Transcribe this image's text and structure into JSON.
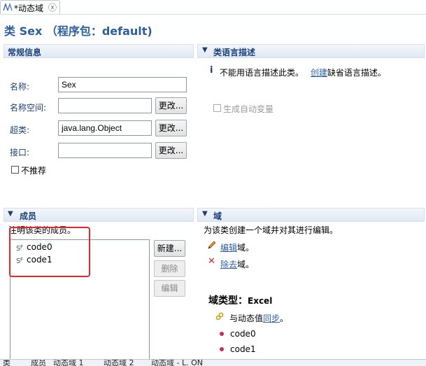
{
  "tab": {
    "title": "*动态域",
    "close": "ⓧ"
  },
  "header": {
    "title": "类 Sex （程序包：default)"
  },
  "general": {
    "title": "常规信息",
    "name_label": "名称:",
    "name_value": "Sex",
    "namespace_label": "名称空间:",
    "namespace_value": "",
    "namespace_change": "更改...",
    "superclass_label": "超类:",
    "superclass_value": "java.lang.Object",
    "superclass_change": "更改...",
    "interface_label": "接口:",
    "interface_value": "",
    "interface_change": "更改...",
    "deprecated_label": "不推荐"
  },
  "language": {
    "title": "类语言描述",
    "info_prefix": "不能用语言描述此类。",
    "create_link": "创建",
    "info_suffix": "缺省语言描述。",
    "auto_var_label": "生成自动变量"
  },
  "members": {
    "title": "成员",
    "description": "注明该类的成员。",
    "items": [
      "code0",
      "code1"
    ],
    "new_button": "新建...",
    "delete_button": "删除",
    "edit_button": "编辑"
  },
  "domain": {
    "title": "域",
    "description": "为该类创建一个域并对其进行编辑。",
    "edit_link": "编辑",
    "edit_suffix": "域。",
    "remove_link": "除去",
    "remove_suffix": "域。",
    "type_label": "域类型：",
    "type_value": "Excel",
    "sync_prefix": "与动态值",
    "sync_link": "同步",
    "sync_suffix": "。",
    "values": [
      "code0",
      "code1"
    ]
  },
  "bottom_tabs": [
    "类",
    "成员",
    "动态域 1",
    "动态域 2",
    "动态域 - L. ON"
  ],
  "colors": {
    "accent": "#2a5fa0",
    "link": "#2b5fa8",
    "highlight": "#e0272c"
  }
}
